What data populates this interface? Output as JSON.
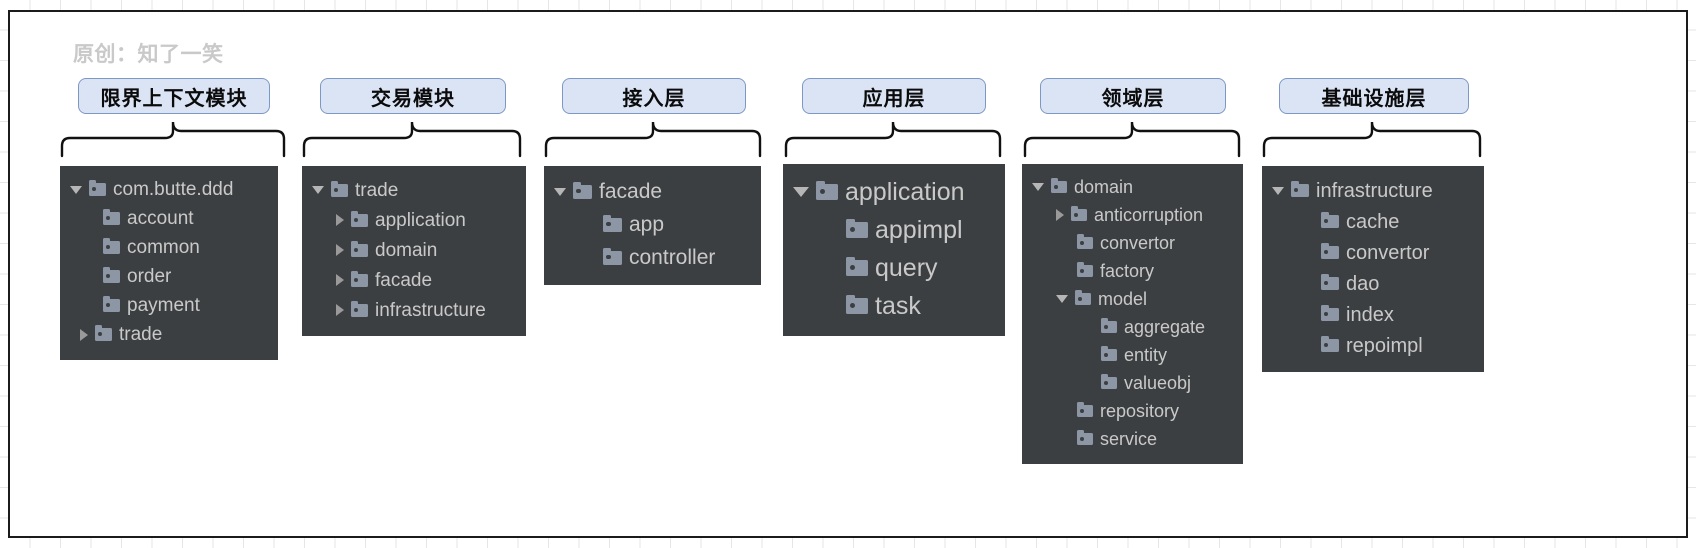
{
  "canvas": {
    "watermark": "原创：知了一笑",
    "background_color": "#ffffff",
    "border_color": "#1b1b1b",
    "grid_color": "#e6e6e6"
  },
  "style": {
    "pill_fill": "#dbe4f5",
    "pill_border": "#7d97c7",
    "panel_bg": "#3c3f41",
    "folder_icon_color": "#8c96a4",
    "tree_text_color": "#c9c9c9",
    "watermark_color": "#c9c9c9"
  },
  "groups": [
    {
      "id": "bounded-context-module",
      "label": "限界上下文模块",
      "tree": [
        {
          "name": "com.butte.ddd",
          "depth": 0,
          "toggle": "down"
        },
        {
          "name": "account",
          "depth": 1,
          "toggle": "none"
        },
        {
          "name": "common",
          "depth": 1,
          "toggle": "none"
        },
        {
          "name": "order",
          "depth": 1,
          "toggle": "none"
        },
        {
          "name": "payment",
          "depth": 1,
          "toggle": "none"
        },
        {
          "name": "trade",
          "depth": 1,
          "toggle": "right"
        }
      ]
    },
    {
      "id": "trade-module",
      "label": "交易模块",
      "tree": [
        {
          "name": "trade",
          "depth": 0,
          "toggle": "down"
        },
        {
          "name": "application",
          "depth": 1,
          "toggle": "right"
        },
        {
          "name": "domain",
          "depth": 1,
          "toggle": "right"
        },
        {
          "name": "facade",
          "depth": 1,
          "toggle": "right"
        },
        {
          "name": "infrastructure",
          "depth": 1,
          "toggle": "right"
        }
      ]
    },
    {
      "id": "access-layer",
      "label": "接入层",
      "tree": [
        {
          "name": "facade",
          "depth": 0,
          "toggle": "down"
        },
        {
          "name": "app",
          "depth": 1,
          "toggle": "none"
        },
        {
          "name": "controller",
          "depth": 1,
          "toggle": "none"
        }
      ]
    },
    {
      "id": "application-layer",
      "label": "应用层",
      "tree": [
        {
          "name": "application",
          "depth": 0,
          "toggle": "down"
        },
        {
          "name": "appimpl",
          "depth": 1,
          "toggle": "none"
        },
        {
          "name": "query",
          "depth": 1,
          "toggle": "none"
        },
        {
          "name": "task",
          "depth": 1,
          "toggle": "none"
        }
      ]
    },
    {
      "id": "domain-layer",
      "label": "领域层",
      "tree": [
        {
          "name": "domain",
          "depth": 0,
          "toggle": "down"
        },
        {
          "name": "anticorruption",
          "depth": 1,
          "toggle": "right"
        },
        {
          "name": "convertor",
          "depth": 1,
          "toggle": "none"
        },
        {
          "name": "factory",
          "depth": 1,
          "toggle": "none"
        },
        {
          "name": "model",
          "depth": 1,
          "toggle": "down"
        },
        {
          "name": "aggregate",
          "depth": 2,
          "toggle": "none"
        },
        {
          "name": "entity",
          "depth": 2,
          "toggle": "none"
        },
        {
          "name": "valueobj",
          "depth": 2,
          "toggle": "none"
        },
        {
          "name": "repository",
          "depth": 1,
          "toggle": "none"
        },
        {
          "name": "service",
          "depth": 1,
          "toggle": "none"
        }
      ]
    },
    {
      "id": "infrastructure-layer",
      "label": "基础设施层",
      "tree": [
        {
          "name": "infrastructure",
          "depth": 0,
          "toggle": "down"
        },
        {
          "name": "cache",
          "depth": 1,
          "toggle": "none"
        },
        {
          "name": "convertor",
          "depth": 1,
          "toggle": "none"
        },
        {
          "name": "dao",
          "depth": 1,
          "toggle": "none"
        },
        {
          "name": "index",
          "depth": 1,
          "toggle": "none"
        },
        {
          "name": "repoimpl",
          "depth": 1,
          "toggle": "none"
        }
      ]
    }
  ]
}
